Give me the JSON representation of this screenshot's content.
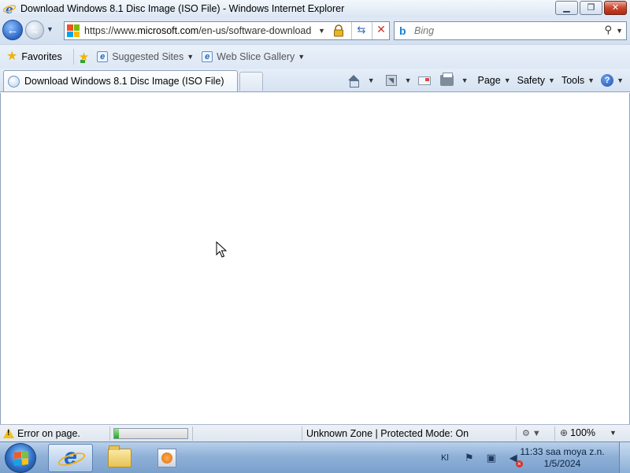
{
  "window": {
    "title": "Download Windows 8.1 Disc Image (ISO File) - Windows Internet Explorer"
  },
  "address_bar": {
    "url_prefix": "https://www.",
    "url_domain": "microsoft.com",
    "url_path": "/en-us/software-download",
    "search_placeholder": "Bing"
  },
  "favorites_bar": {
    "favorites_label": "Favorites",
    "links": [
      "Suggested Sites",
      "Web Slice Gallery"
    ]
  },
  "tabs": [
    {
      "label": "Download Windows 8.1 Disc Image (ISO File)"
    }
  ],
  "commands": {
    "page": "Page",
    "safety": "Safety",
    "tools": "Tools"
  },
  "status_bar": {
    "message": "Error on page.",
    "progress_fraction": 0.06,
    "zone": "Unknown Zone | Protected Mode: On",
    "zoom": "100%"
  },
  "taskbar": {
    "language": "Kl",
    "time": "11:33 saa moya z.n.",
    "date": "1/5/2024"
  },
  "colors": {
    "accent": "#2a66c4",
    "close_button": "#c8462c",
    "progress": "#1fa91b"
  }
}
